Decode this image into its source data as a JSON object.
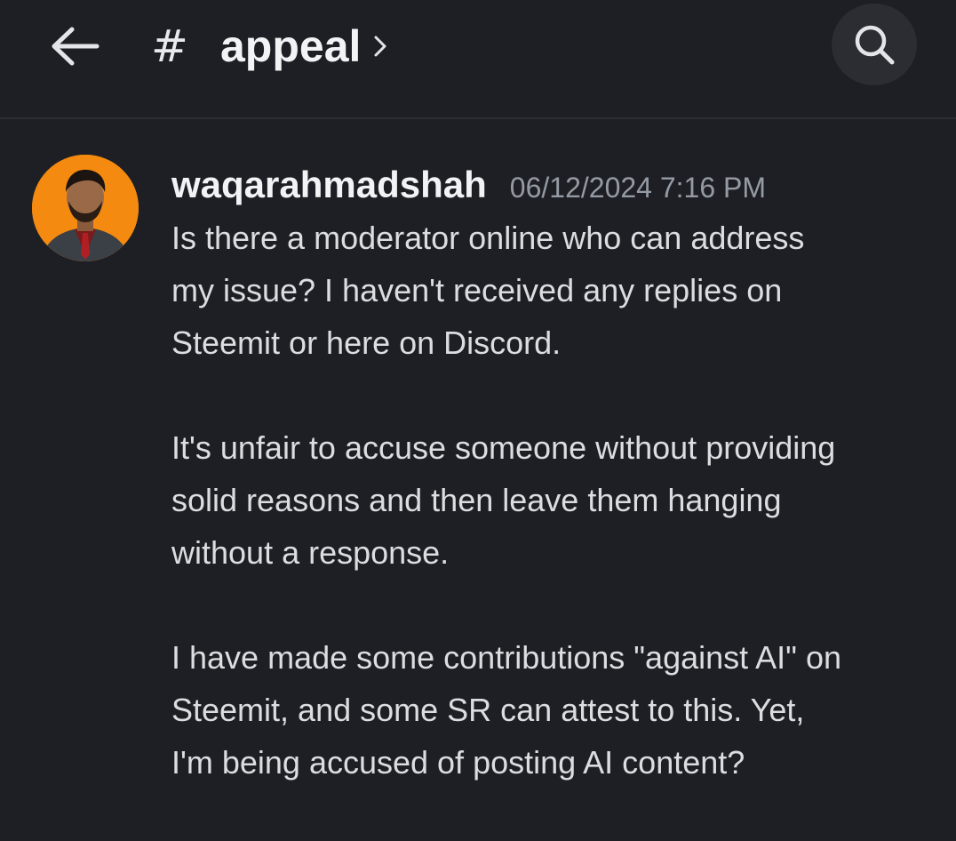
{
  "header": {
    "back_icon": "arrow-left-icon",
    "hash_symbol": "#",
    "channel_name": "appeal",
    "chevron_icon": "chevron-right-icon",
    "search_icon": "search-icon"
  },
  "message": {
    "author": "waqarahmadshah",
    "timestamp": "06/12/2024 7:16 PM",
    "avatar_bg": "#f58a10",
    "paragraphs": [
      {
        "lines": [
          "Is there a moderator online who can address",
          "my issue? I haven't received any replies on",
          "Steemit or here on Discord."
        ]
      },
      {
        "lines": [
          "It's unfair to accuse someone without providing",
          "solid reasons and then leave them hanging",
          "without a response."
        ]
      },
      {
        "lines": [
          "I have made some contributions \"against AI\" on",
          "Steemit, and some SR can attest to this. Yet,",
          "I'm being accused of posting AI content?"
        ]
      }
    ]
  },
  "colors": {
    "background": "#1e1f24",
    "header_border": "#2b2d31",
    "text_primary": "#f2f3f5",
    "text_body": "#dbdee1",
    "text_muted": "#949ba4",
    "search_button_bg": "#2b2d33"
  }
}
